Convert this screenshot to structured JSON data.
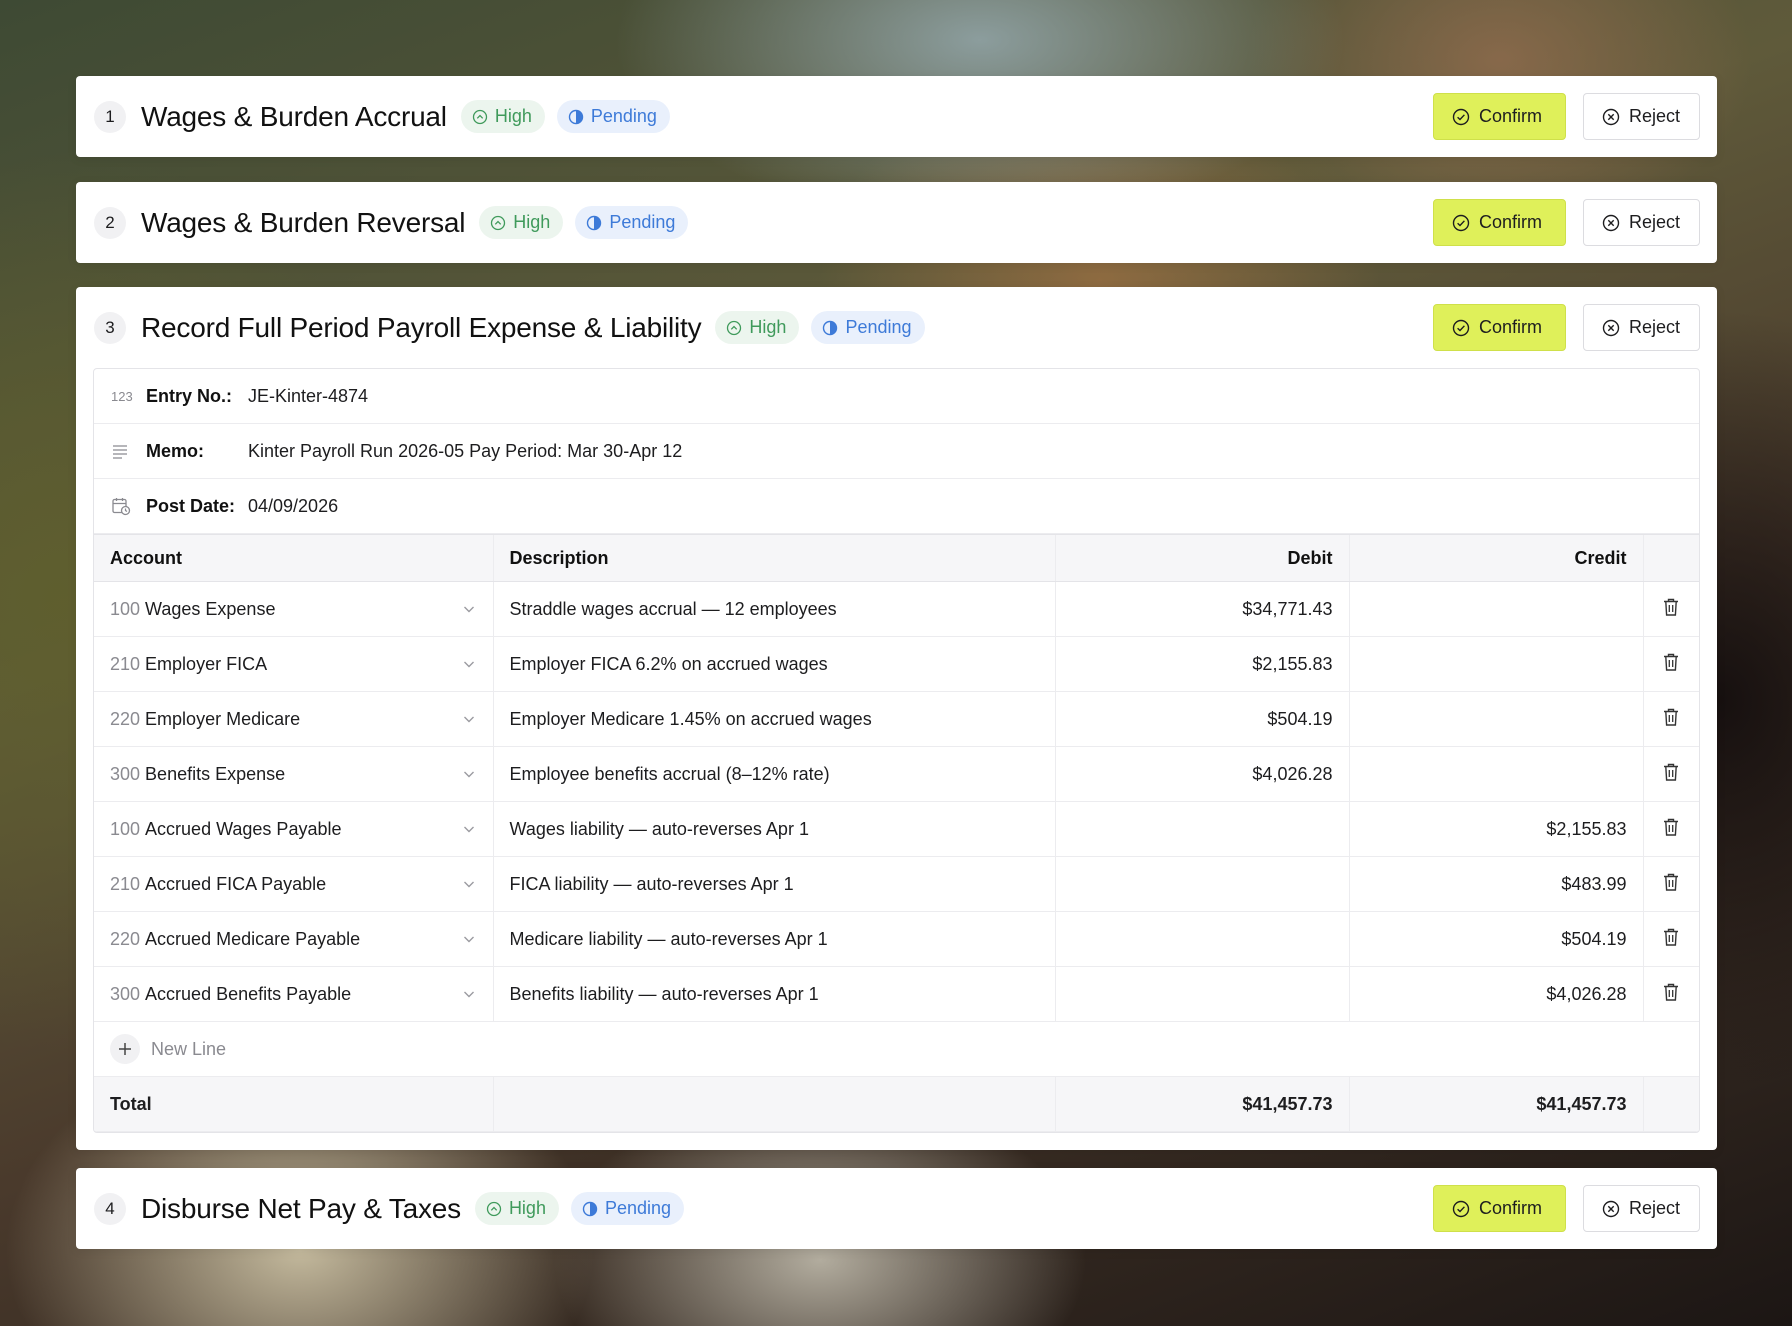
{
  "steps": [
    {
      "num": "1",
      "title": "Wages & Burden Accrual",
      "priority": "High",
      "status": "Pending",
      "confirm": "Confirm",
      "reject": "Reject"
    },
    {
      "num": "2",
      "title": "Wages & Burden Reversal",
      "priority": "High",
      "status": "Pending",
      "confirm": "Confirm",
      "reject": "Reject"
    },
    {
      "num": "3",
      "title": "Record Full Period Payroll Expense & Liability",
      "priority": "High",
      "status": "Pending",
      "confirm": "Confirm",
      "reject": "Reject"
    },
    {
      "num": "4",
      "title": "Disburse Net Pay & Taxes",
      "priority": "High",
      "status": "Pending",
      "confirm": "Confirm",
      "reject": "Reject"
    }
  ],
  "entry": {
    "entry_no_label": "Entry No.:",
    "entry_no": "JE-Kinter-4874",
    "entry_icon_text": "123",
    "memo_label": "Memo:",
    "memo": "Kinter Payroll Run 2026-05 Pay Period: Mar 30-Apr 12",
    "post_date_label": "Post Date:",
    "post_date": "04/09/2026"
  },
  "table": {
    "headers": {
      "account": "Account",
      "description": "Description",
      "debit": "Debit",
      "credit": "Credit"
    },
    "rows": [
      {
        "code": "100",
        "account": "Wages Expense",
        "description": "Straddle wages accrual — 12 employees",
        "debit": "$34,771.43",
        "credit": ""
      },
      {
        "code": "210",
        "account": "Employer FICA",
        "description": "Employer FICA 6.2% on accrued wages",
        "debit": "$2,155.83",
        "credit": ""
      },
      {
        "code": "220",
        "account": "Employer Medicare",
        "description": "Employer Medicare 1.45% on accrued wages",
        "debit": "$504.19",
        "credit": ""
      },
      {
        "code": "300",
        "account": "Benefits Expense",
        "description": "Employee benefits accrual (8–12% rate)",
        "debit": "$4,026.28",
        "credit": ""
      },
      {
        "code": "100",
        "account": "Accrued Wages Payable",
        "description": "Wages liability — auto-reverses Apr 1",
        "debit": "",
        "credit": "$2,155.83"
      },
      {
        "code": "210",
        "account": "Accrued FICA Payable",
        "description": "FICA liability — auto-reverses Apr 1",
        "debit": "",
        "credit": "$483.99"
      },
      {
        "code": "220",
        "account": "Accrued Medicare Payable",
        "description": "Medicare liability — auto-reverses Apr 1",
        "debit": "",
        "credit": "$504.19"
      },
      {
        "code": "300",
        "account": "Accrued Benefits Payable",
        "description": "Benefits liability — auto-reverses Apr 1",
        "debit": "",
        "credit": "$4,026.28"
      }
    ],
    "new_line_label": "New Line",
    "total_label": "Total",
    "total_debit": "$41,457.73",
    "total_credit": "$41,457.73"
  },
  "colors": {
    "confirm_bg": "#dff05a",
    "high_text": "#3f9a5b",
    "high_bg": "#ecf5ee",
    "pending_text": "#3d7ad8",
    "pending_bg": "#e9f0fc"
  }
}
